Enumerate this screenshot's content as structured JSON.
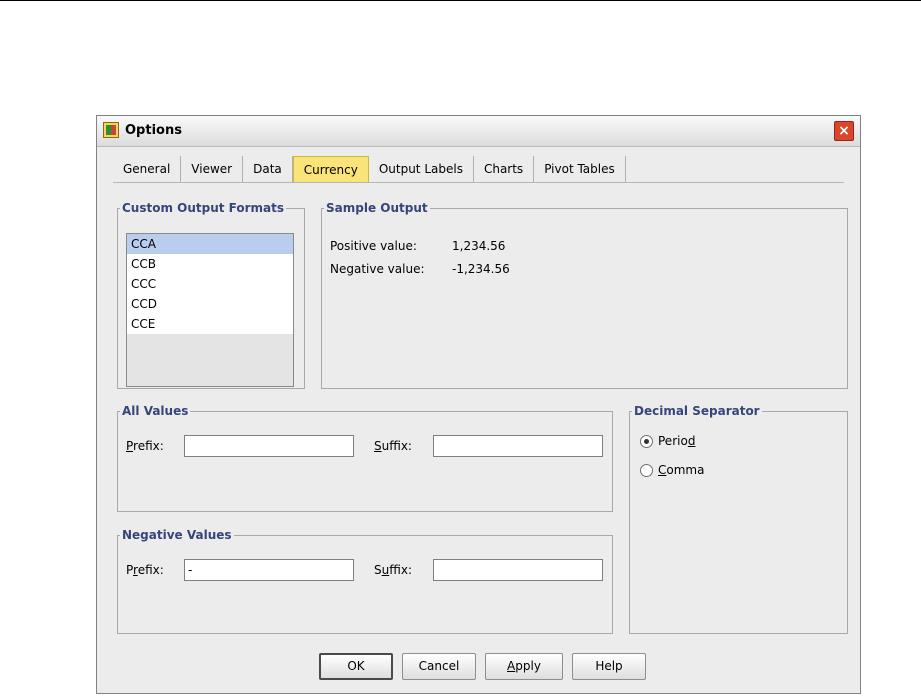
{
  "window": {
    "title": "Options",
    "close_symbol": "×"
  },
  "tabs": [
    {
      "label": "General"
    },
    {
      "label": "Viewer"
    },
    {
      "label": "Data"
    },
    {
      "label": "Currency",
      "active": true
    },
    {
      "label": "Output Labels"
    },
    {
      "label": "Charts"
    },
    {
      "label": "Pivot Tables"
    }
  ],
  "custom_formats": {
    "legend": "Custom Output Formats",
    "items": [
      "CCA",
      "CCB",
      "CCC",
      "CCD",
      "CCE"
    ],
    "selected": "CCA"
  },
  "sample_output": {
    "legend": "Sample Output",
    "positive_label": "Positive value:",
    "positive_value": "1,234.56",
    "negative_label": "Negative value:",
    "negative_value": "-1,234.56"
  },
  "all_values": {
    "legend": "All Values",
    "prefix_label_u": "P",
    "prefix_label_rest": "refix:",
    "prefix_value": "",
    "suffix_label_u": "S",
    "suffix_label_rest": "uffix:",
    "suffix_value": ""
  },
  "negative_values": {
    "legend": "Negative Values",
    "prefix_label_a": "P",
    "prefix_label_u": "r",
    "prefix_label_b": "efix:",
    "prefix_value": "-",
    "suffix_label_a": "S",
    "suffix_label_u": "u",
    "suffix_label_b": "ffix:",
    "suffix_value": ""
  },
  "decimal_separator": {
    "legend": "Decimal Separator",
    "period_a": "Perio",
    "period_u": "d",
    "comma_u": "C",
    "comma_b": "omma",
    "selected": "Period"
  },
  "buttons": {
    "ok": "OK",
    "cancel": "Cancel",
    "apply_u": "A",
    "apply_b": "pply",
    "help": "Help"
  },
  "colors": {
    "active_tab": "#f9e47a",
    "legend_text": "#36457a",
    "selected_item": "#b9cdef",
    "close_button": "#d9462b"
  }
}
